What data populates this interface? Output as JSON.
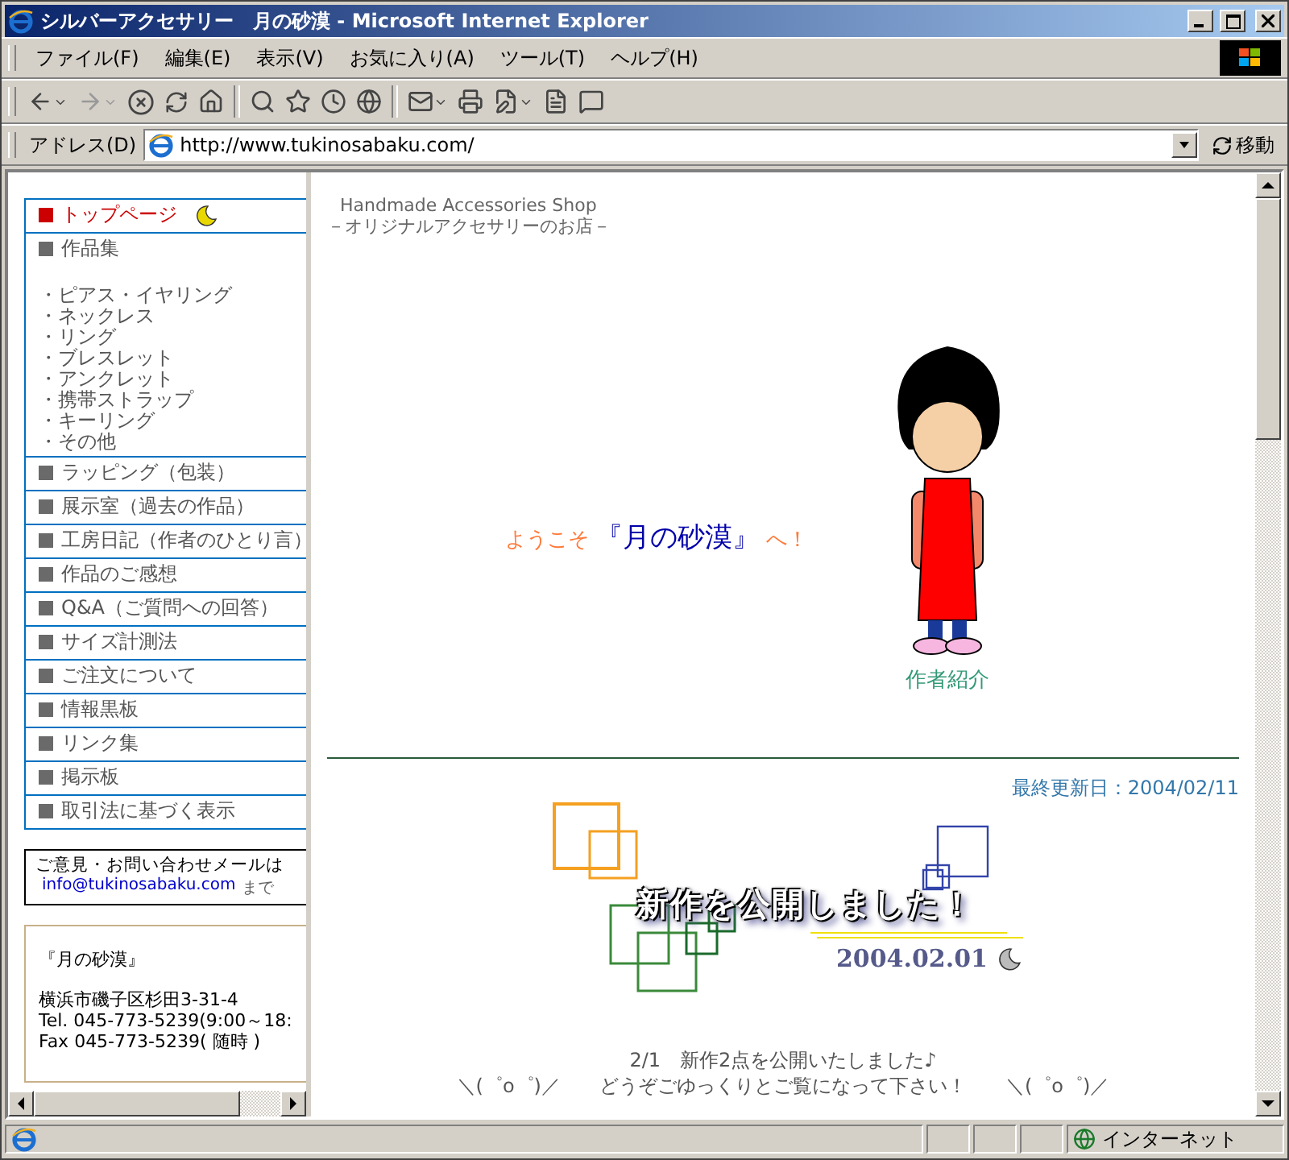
{
  "window": {
    "title": "シルバーアクセサリー　月の砂漠 - Microsoft Internet Explorer"
  },
  "menu_bar": [
    "ファイル(F)",
    "編集(E)",
    "表示(V)",
    "お気に入り(A)",
    "ツール(T)",
    "ヘルプ(H)"
  ],
  "address_bar": {
    "label": "アドレス(D)",
    "url": "http://www.tukinosabaku.com/",
    "go_button": "移動"
  },
  "sidebar": {
    "nav": [
      {
        "label": "トップページ",
        "selected": true
      },
      {
        "label": "作品集",
        "selected": false,
        "children": [
          {
            "label": "・ピアス・イヤリング"
          },
          {
            "label": "・ネックレス"
          },
          {
            "label": "・リング"
          },
          {
            "label": "・ブレスレット"
          },
          {
            "label": "・アンクレット"
          },
          {
            "label": "・携帯ストラップ"
          },
          {
            "label": "・キーリング"
          },
          {
            "label": "・その他"
          }
        ]
      },
      {
        "label": "ラッピング（包装）",
        "selected": false
      },
      {
        "label": "展示室（過去の作品）",
        "selected": false
      },
      {
        "label": "工房日記（作者のひとり言）",
        "selected": false
      },
      {
        "label": "作品のご感想",
        "selected": false
      },
      {
        "label": "Q&A（ご質問への回答）",
        "selected": false
      },
      {
        "label": "サイズ計測法",
        "selected": false
      },
      {
        "label": "ご注文について",
        "selected": false
      },
      {
        "label": "情報黒板",
        "selected": false
      },
      {
        "label": "リンク集",
        "selected": false
      },
      {
        "label": "掲示板",
        "selected": false
      },
      {
        "label": "取引法に基づく表示",
        "selected": false
      }
    ],
    "mail": {
      "text": "ご意見・お問い合わせメールは",
      "email": "info@tukinosabaku.com",
      "suffix": "まで"
    },
    "shop_info": {
      "name": "『月の砂漠』",
      "lines": [
        "横浜市磯子区杉田3-31-4",
        "Tel. 045-773-5239(9:00～18:",
        "Fax 045-773-5239( 随時 )"
      ]
    }
  },
  "main": {
    "tagline": [
      "Handmade Accessories Shop",
      "－オリジナルアクセサリーのお店－"
    ],
    "welcome": {
      "prefix": "ようこそ",
      "name": "『月の砂漠』",
      "suffix": "へ！"
    },
    "profile_link": "作者紹介",
    "last_updated": "最終更新日：2004/02/11",
    "banner": {
      "headline": "新作を公開しました！",
      "date": "2004.02.01"
    },
    "notice": [
      "2/1　新作2点を公開いたしました♪",
      "＼(゜o゜)／　　どうぞごゆっくりとご覧になって下さい！　　＼(゜o゜)／"
    ]
  },
  "status_bar": {
    "zone": "インターネット"
  }
}
